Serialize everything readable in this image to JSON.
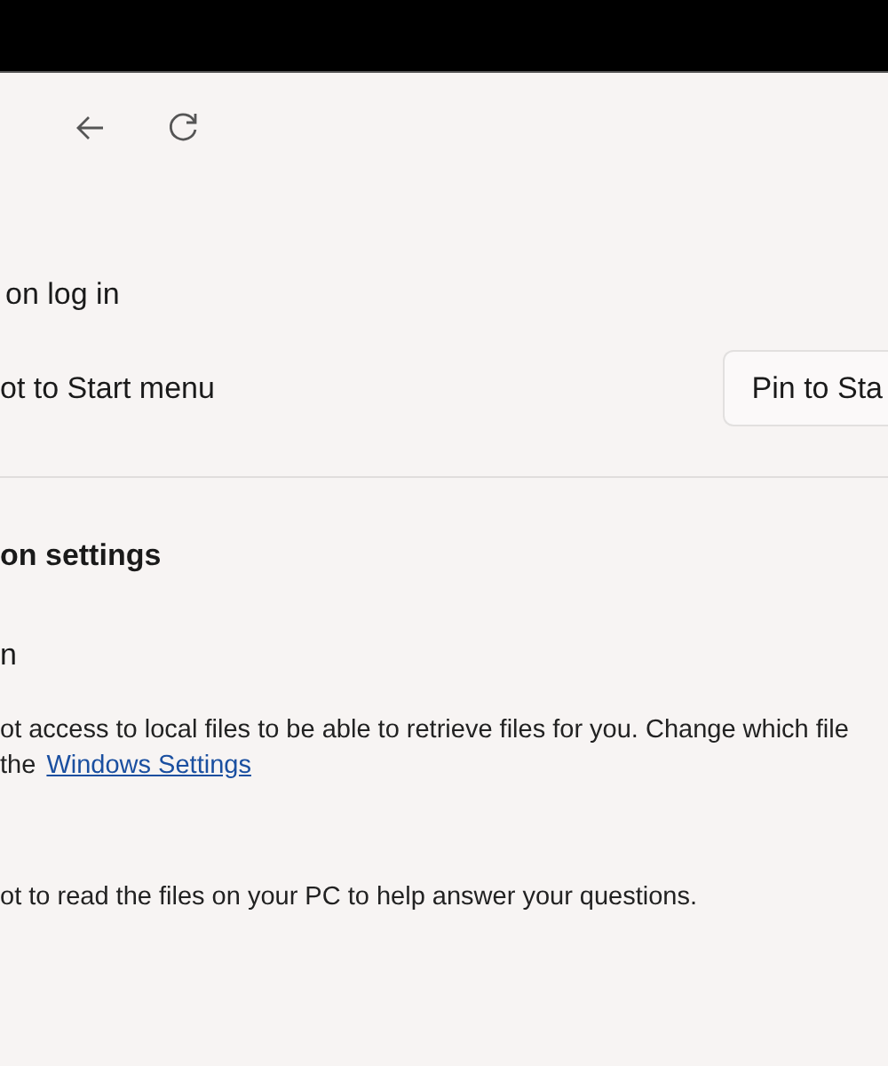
{
  "toolbar": {
    "buttons": [
      {
        "kind": "back"
      },
      {
        "kind": "refresh"
      }
    ]
  },
  "rows": [
    {
      "label": "on log in"
    },
    {
      "label": "ot to Start menu",
      "button": "Pin to Sta"
    }
  ],
  "section": {
    "title": "on settings",
    "items": [
      {
        "label": "n",
        "description_lines": [
          "ot access to local files to be able to retrieve files for you. Change which file",
          "the"
        ],
        "link": "Windows Settings"
      },
      {
        "description_lines": [
          "ot to read the files on your PC to help answer your questions."
        ]
      }
    ]
  }
}
